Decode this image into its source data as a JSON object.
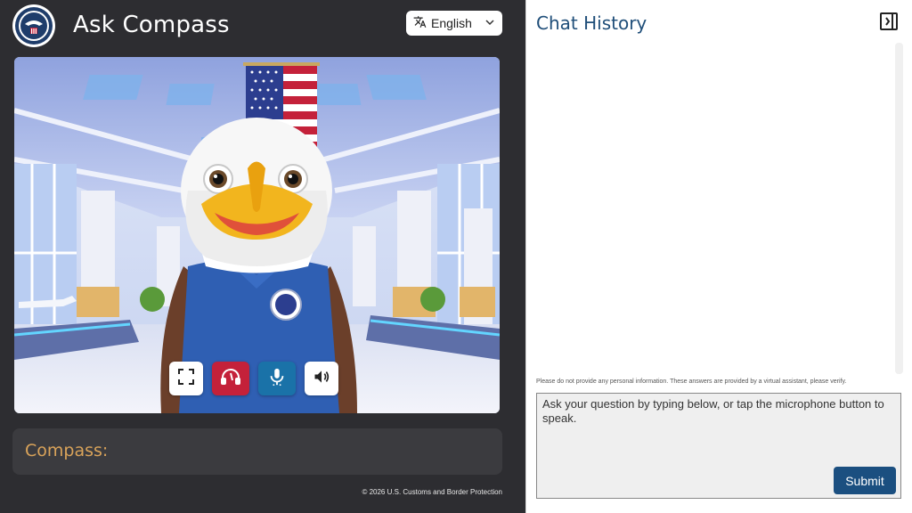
{
  "header": {
    "title": "Ask Compass"
  },
  "language": {
    "selected": "English",
    "icon": "translate-icon"
  },
  "controls": [
    {
      "name": "fullscreen-button",
      "icon": "fullscreen-icon"
    },
    {
      "name": "end-call-button",
      "icon": "headset-off-icon"
    },
    {
      "name": "microphone-button",
      "icon": "microphone-icon"
    },
    {
      "name": "volume-button",
      "icon": "speaker-icon"
    }
  ],
  "transcript": {
    "label": "Compass:"
  },
  "footer": {
    "copyright": "© 2026 U.S. Customs and Border Protection"
  },
  "chat": {
    "title": "Chat History",
    "disclaimer": "Please do not provide any personal information. These answers are provided by a virtual assistant, please verify.",
    "input_placeholder": "Ask your question by typing below, or tap the microphone button to speak.",
    "submit_label": "Submit"
  },
  "colors": {
    "accent": "#1b4f80",
    "compass_label": "#d9a35a",
    "end_call": "#c4213a",
    "mic": "#1a72a8"
  }
}
